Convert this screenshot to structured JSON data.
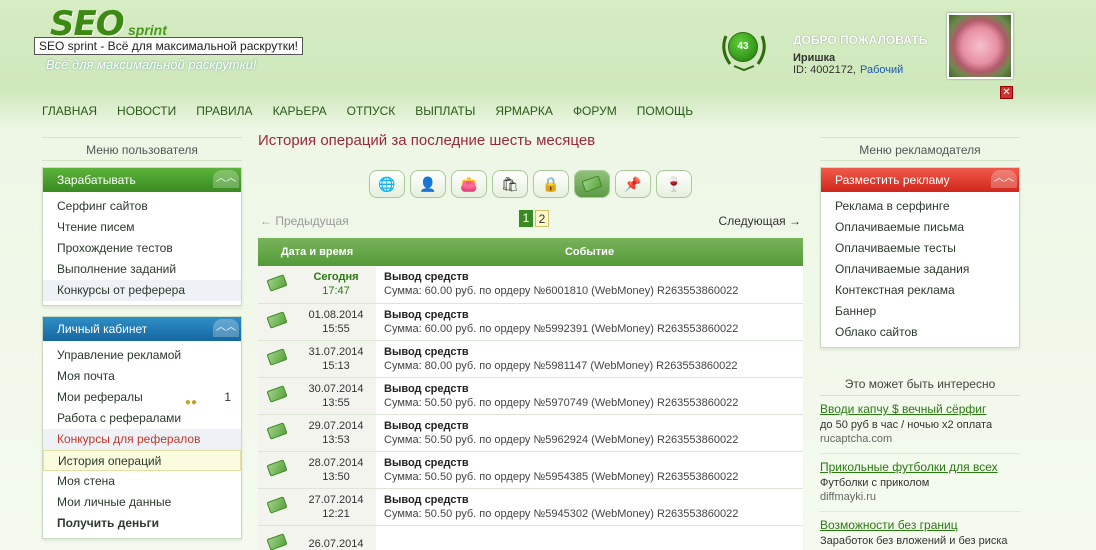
{
  "header": {
    "logo_text": "SEO",
    "logo_small": "sprint",
    "tooltip": "SEO sprint - Всё для максимальной раскрутки!",
    "slogan": "Всё для максимальной раскрутки!",
    "rating": "43",
    "welcome_title": "ДОБРО ПОЖАЛОВАТЬ",
    "username": "Иришка",
    "user_id": "ID: 4002172,",
    "status_link": "Рабочий",
    "close": "✕"
  },
  "nav": [
    "ГЛАВНАЯ",
    "НОВОСТИ",
    "ПРАВИЛА",
    "КАРЬЕРА",
    "ОТПУСК",
    "ВЫПЛАТЫ",
    "ЯРМАРКА",
    "ФОРУМ",
    "ПОМОЩЬ"
  ],
  "left": {
    "head": "Меню пользователя",
    "earn": {
      "title": "Зарабатывать",
      "items": [
        "Серфинг сайтов",
        "Чтение писем",
        "Прохождение тестов",
        "Выполнение заданий",
        "Конкурсы от реферера"
      ]
    },
    "cabinet": {
      "title": "Личный кабинет",
      "items": [
        "Управление рекламой",
        "Моя почта",
        "Мои рефералы",
        "Работа с рефералами",
        "Конкурсы для рефералов",
        "История операций",
        "Моя стена",
        "Мои личные данные",
        "Получить деньги"
      ],
      "referrals_count": "1"
    }
  },
  "right": {
    "head": "Меню рекламодателя",
    "ads": {
      "title": "Разместить рекламу",
      "items": [
        "Реклама в серфинге",
        "Оплачиваемые письма",
        "Оплачиваемые тесты",
        "Оплачиваемые задания",
        "Контекстная реклама",
        "Баннер",
        "Облако сайтов"
      ]
    },
    "interest_head": "Это может быть интересно",
    "promos": [
      {
        "title": "Вводи капчу $ вечный сёрфиг",
        "desc": "до 50 руб в час / ночью x2 оплата",
        "url": "rucaptcha.com"
      },
      {
        "title": "Прикольные футболки для всех",
        "desc": "Футболки с приколом",
        "url": "diffmayki.ru"
      },
      {
        "title": "Возможности без границ",
        "desc": "Заработок без вложений и без риска",
        "url": ""
      }
    ]
  },
  "main": {
    "title": "История операций за последние шесть месяцев",
    "tab_icons": [
      "globe-icon",
      "person-icon",
      "wallet-icon",
      "bag-icon",
      "lock-icon",
      "money-icon",
      "pin-icon",
      "glass-icon"
    ],
    "prev": "← Предыдущая",
    "next": "Следующая →",
    "pages": [
      "1",
      "2"
    ],
    "col_date": "Дата и время",
    "col_event": "Событие",
    "rows": [
      {
        "date": "Сегодня",
        "time": "17:47",
        "event": "Вывод средств",
        "desc": "Сумма: 60.00 руб. по ордеру №6001810 (WebMoney) R263553860022"
      },
      {
        "date": "01.08.2014",
        "time": "15:55",
        "event": "Вывод средств",
        "desc": "Сумма: 60.00 руб. по ордеру №5992391 (WebMoney) R263553860022"
      },
      {
        "date": "31.07.2014",
        "time": "15:13",
        "event": "Вывод средств",
        "desc": "Сумма: 80.00 руб. по ордеру №5981147 (WebMoney) R263553860022"
      },
      {
        "date": "30.07.2014",
        "time": "13:55",
        "event": "Вывод средств",
        "desc": "Сумма: 50.50 руб. по ордеру №5970749 (WebMoney) R263553860022"
      },
      {
        "date": "29.07.2014",
        "time": "13:53",
        "event": "Вывод средств",
        "desc": "Сумма: 50.50 руб. по ордеру №5962924 (WebMoney) R263553860022"
      },
      {
        "date": "28.07.2014",
        "time": "13:50",
        "event": "Вывод средств",
        "desc": "Сумма: 50.50 руб. по ордеру №5954385 (WebMoney) R263553860022"
      },
      {
        "date": "27.07.2014",
        "time": "12:21",
        "event": "Вывод средств",
        "desc": "Сумма: 50.50 руб. по ордеру №5945302 (WebMoney) R263553860022"
      },
      {
        "date": "26.07.2014",
        "time": "",
        "event": "",
        "desc": ""
      }
    ]
  },
  "colors": {
    "accent_green": "#3a8a22",
    "title_red": "#9a2a3a",
    "link_blue": "#1a5aa8"
  }
}
